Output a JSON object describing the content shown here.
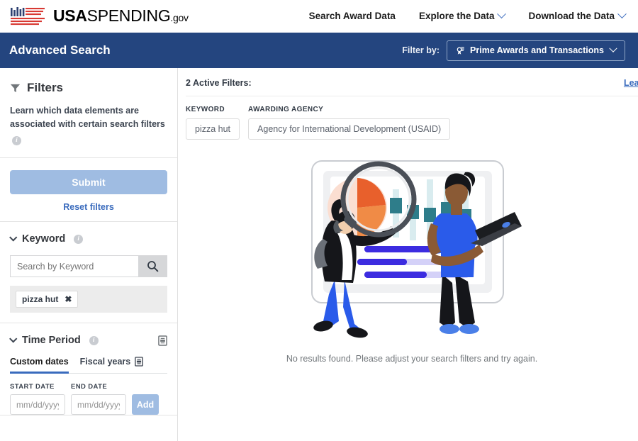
{
  "header": {
    "logo_icon": "usa-flag-barchart-logo",
    "brand_usa": "USA",
    "brand_spending": "SPENDING",
    "brand_gov": ".gov",
    "nav": [
      {
        "label": "Search Award Data",
        "has_chevron": false
      },
      {
        "label": "Explore the Data",
        "has_chevron": true
      },
      {
        "label": "Download the Data",
        "has_chevron": true
      }
    ]
  },
  "bluebar": {
    "title": "Advanced Search",
    "filter_by_label": "Filter by:",
    "filter_pill_label": "Prime Awards and Transactions",
    "filter_pill_icon": "award-ribbon-icon",
    "background_color": "#24457f"
  },
  "sidebar": {
    "filters_title": "Filters",
    "filters_icon": "funnel-icon",
    "filters_description": "Learn which data elements are associated with certain search filters",
    "submit_label": "Submit",
    "submit_color": "#9fbce2",
    "reset_label": "Reset filters",
    "keyword": {
      "title": "Keyword",
      "search_placeholder": "Search by Keyword",
      "search_value": "",
      "search_icon": "magnifier-icon",
      "tags": [
        {
          "label": "pizza hut",
          "remove_icon": "close-x-icon"
        }
      ]
    },
    "time_period": {
      "title": "Time Period",
      "glossary_icon": "book-icon",
      "tabs": [
        {
          "label": "Custom dates",
          "active": true,
          "has_book_icon": false
        },
        {
          "label": "Fiscal years",
          "active": false,
          "has_book_icon": true
        }
      ],
      "start_label": "START DATE",
      "start_placeholder": "mm/dd/yyyy",
      "start_value": "",
      "end_label": "END DATE",
      "end_placeholder": "mm/dd/yyyy",
      "end_value": "",
      "add_label": "Add"
    }
  },
  "main": {
    "active_filters_title": "2 Active Filters:",
    "learn_link": "Learn",
    "filter_groups": [
      {
        "label": "KEYWORD",
        "chips": [
          "pizza hut"
        ]
      },
      {
        "label": "AWARDING AGENCY",
        "chips": [
          "Agency for International Development (USAID)"
        ]
      }
    ],
    "empty_state": {
      "illustration_icon": "no-results-people-dashboard-illustration",
      "message": "No results found. Please adjust your search filters and try again."
    }
  },
  "colors": {
    "brand_navy": "#24457f",
    "link_blue": "#3a6bbd",
    "disabled_blue": "#9fbce2",
    "flag_red": "#d83933",
    "flag_navy": "#2e4172"
  }
}
